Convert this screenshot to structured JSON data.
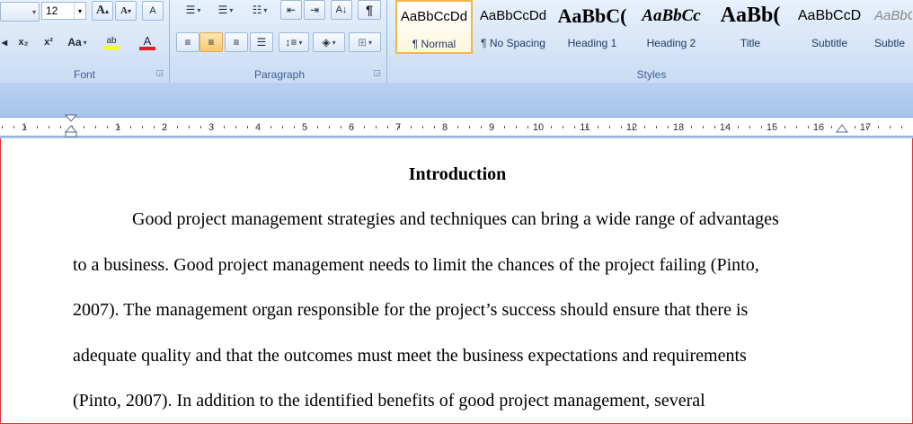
{
  "ribbon": {
    "font": {
      "label": "Font",
      "size": "12",
      "grow": "A",
      "shrink": "A",
      "clear": "A",
      "subscript": "x₂",
      "superscript": "x²",
      "change_case": "Aa",
      "highlight": "ab",
      "font_color": "A"
    },
    "paragraph": {
      "label": "Paragraph",
      "pilcrow": "¶"
    },
    "styles": {
      "label": "Styles",
      "items": [
        {
          "preview": "AaBbCcDd",
          "name": "¶ Normal"
        },
        {
          "preview": "AaBbCcDd",
          "name": "¶ No Spacing"
        },
        {
          "preview": "AaBbC(",
          "name": "Heading 1"
        },
        {
          "preview": "AaBbCc",
          "name": "Heading 2"
        },
        {
          "preview": "AaBb(",
          "name": "Title"
        },
        {
          "preview": "AaBbCcD",
          "name": "Subtitle"
        },
        {
          "preview": "AaBbC",
          "name": "Subtle"
        }
      ]
    }
  },
  "ruler": {
    "numbers": [
      "1",
      "1",
      "2",
      "3",
      "4",
      "5",
      "6",
      "7",
      "8",
      "9",
      "10",
      "11",
      "12",
      "13",
      "14",
      "15",
      "16",
      "17"
    ]
  },
  "document": {
    "title": "Introduction",
    "lines": [
      "Good project management strategies and techniques can bring a wide range of advantages",
      "to a business. Good project management needs to limit the chances of the project failing (Pinto,",
      "2007). The management organ responsible for the project’s success should ensure that there is",
      "adequate quality and that the outcomes must meet the business expectations and requirements",
      "(Pinto, 2007). In addition to the identified benefits of good project management, several"
    ]
  },
  "colors": {
    "highlight": "#ffff00",
    "font_color": "#e02020",
    "active_style_border": "#f3b84a",
    "window_border": "#dd3333"
  }
}
